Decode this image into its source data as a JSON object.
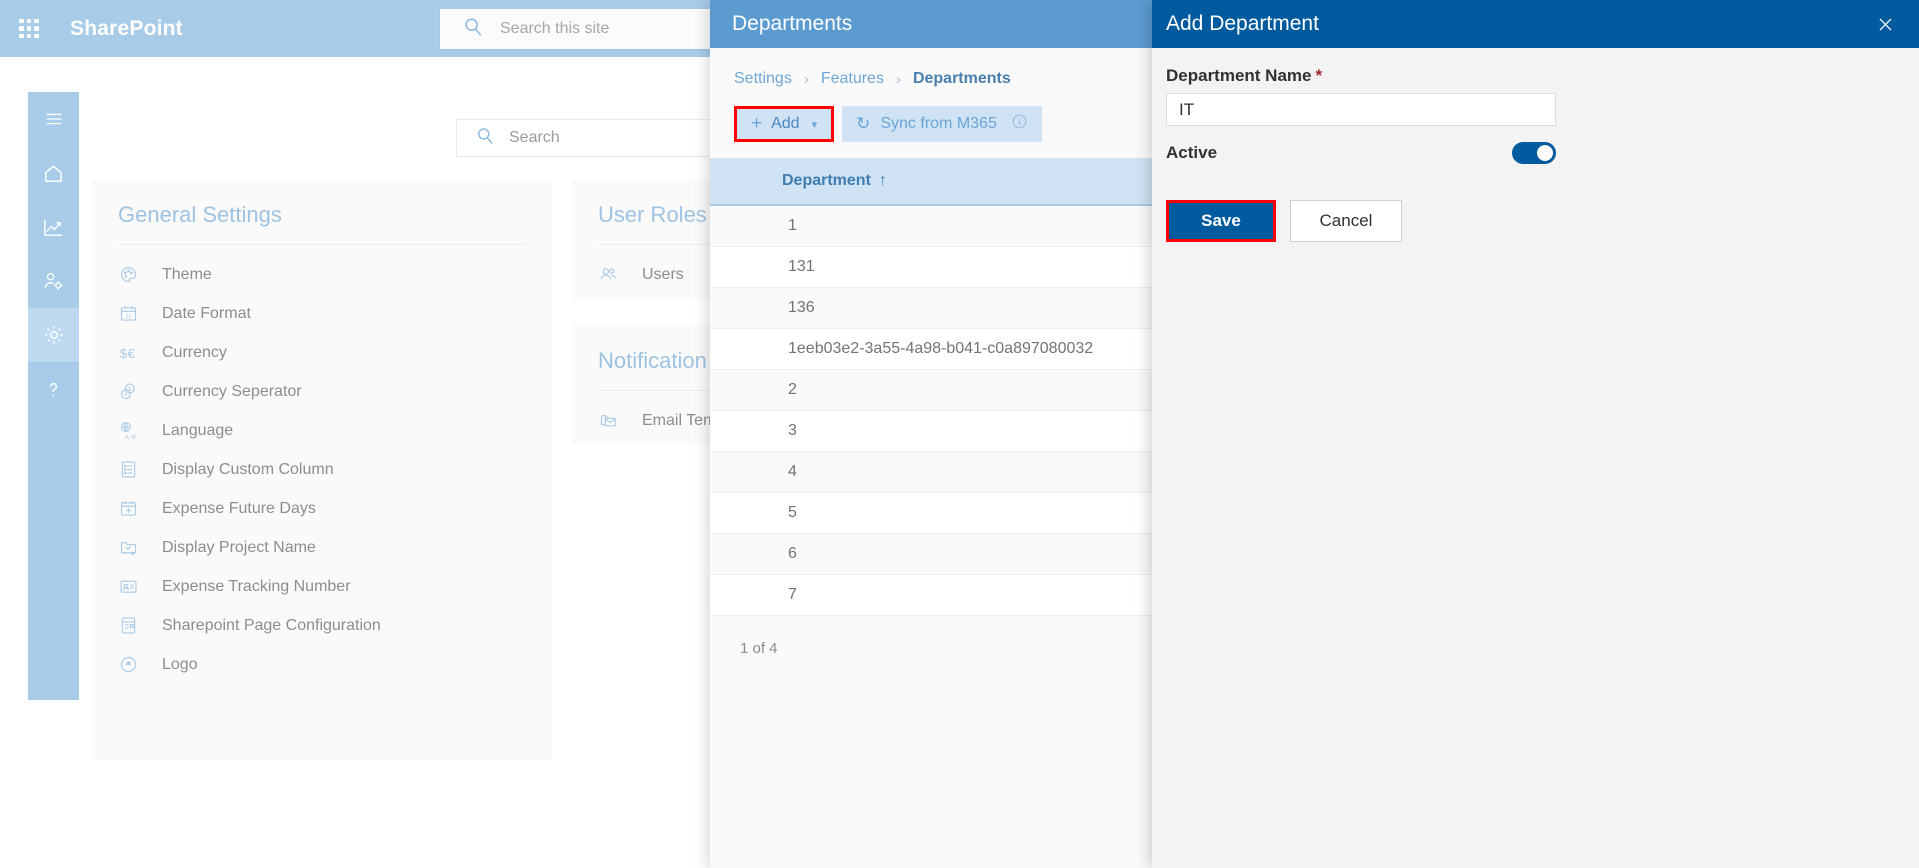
{
  "suite": {
    "brand": "SharePoint",
    "search_placeholder": "Search this site",
    "waffle_icon": "app-launcher-icon",
    "search_icon": "search-icon"
  },
  "rail": {
    "items": [
      {
        "name": "menu",
        "icon": "hamburger-icon",
        "active": false
      },
      {
        "name": "home",
        "icon": "home-icon",
        "active": false
      },
      {
        "name": "reports",
        "icon": "trending-chart-icon",
        "active": false
      },
      {
        "name": "user-management",
        "icon": "user-settings-icon",
        "active": false
      },
      {
        "name": "settings",
        "icon": "gear-icon",
        "active": true
      },
      {
        "name": "help",
        "icon": "question-mark-icon",
        "active": false
      }
    ]
  },
  "page": {
    "search_placeholder": "Search",
    "search_icon": "search-icon"
  },
  "general_settings": {
    "title": "General Settings",
    "items": [
      {
        "label": "Theme",
        "icon": "palette-icon"
      },
      {
        "label": "Date Format",
        "icon": "calendar-21-icon"
      },
      {
        "label": "Currency",
        "icon": "dollar-euro-icon"
      },
      {
        "label": "Currency Seperator",
        "icon": "coins-icon"
      },
      {
        "label": "Language",
        "icon": "translate-icon"
      },
      {
        "label": "Display Custom Column",
        "icon": "list-document-icon"
      },
      {
        "label": "Expense Future Days",
        "icon": "calendar-plus-icon"
      },
      {
        "label": "Display Project Name",
        "icon": "folder-check-plus-icon"
      },
      {
        "label": "Expense Tracking Number",
        "icon": "id-card-icon"
      },
      {
        "label": "Sharepoint Page Configuration",
        "icon": "page-config-icon"
      },
      {
        "label": "Logo",
        "icon": "logo-badge-icon"
      }
    ]
  },
  "user_roles_card": {
    "title": "User Roles a",
    "items": [
      {
        "label": "Users",
        "icon": "people-icon"
      }
    ]
  },
  "notifications_card": {
    "title": "Notification",
    "items": [
      {
        "label": "Email Tem",
        "icon": "email-template-icon"
      }
    ]
  },
  "departments_panel": {
    "header_title": "Departments",
    "breadcrumb": {
      "items": [
        "Settings",
        "Features",
        "Departments"
      ],
      "separator": "›"
    },
    "toolbar": {
      "add_label": "Add",
      "add_icon": "plus-icon",
      "add_chevron_icon": "chevron-down-icon",
      "sync_label": "Sync from M365",
      "sync_icon": "refresh-icon",
      "info_icon": "info-circle-icon"
    },
    "table": {
      "column_header": "Department",
      "sort_icon": "↑",
      "rows": [
        "1",
        "131",
        "136",
        "1eeb03e2-3a55-4a98-b041-c0a897080032",
        "2",
        "3",
        "4",
        "5",
        "6",
        "7"
      ]
    },
    "pager_text": "1 of 4"
  },
  "add_department_panel": {
    "header_title": "Add Department",
    "close_icon": "close-icon",
    "name_label": "Department Name",
    "required_marker": "*",
    "name_value": "IT",
    "active_label": "Active",
    "active_on": true,
    "save_label": "Save",
    "cancel_label": "Cancel"
  },
  "colors": {
    "suite_bar": "#a8cce8",
    "panel_header": "#5b9bd0",
    "add_panel_header": "#005a9e",
    "accent": "#005a9e",
    "highlight_outline": "#ff0000",
    "table_header_bg": "#cfe3f4"
  }
}
